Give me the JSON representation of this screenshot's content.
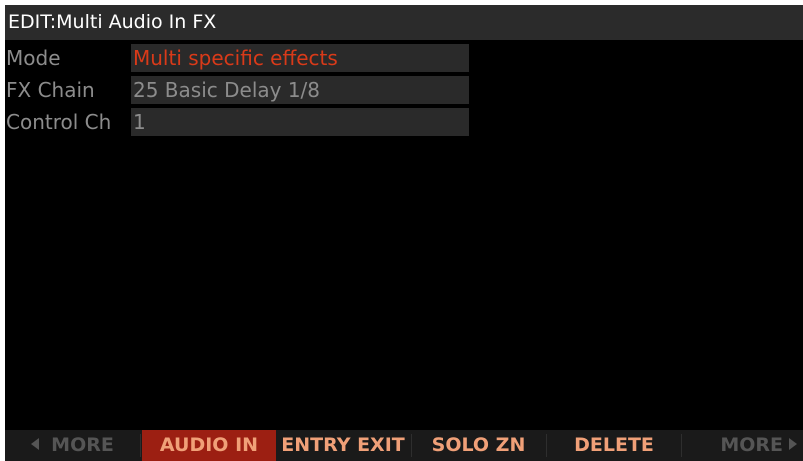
{
  "header": {
    "title": "EDIT:Multi Audio In FX"
  },
  "params": [
    {
      "label": "Mode",
      "value": "Multi specific effects"
    },
    {
      "label": "FX Chain",
      "value": "25 Basic Delay 1/8"
    },
    {
      "label": "Control Ch",
      "value": "1"
    }
  ],
  "softkeys": [
    {
      "label": "MORE",
      "state": "disabled"
    },
    {
      "label": "AUDIO IN",
      "state": "selected"
    },
    {
      "label": "ENTRY EXIT",
      "state": "enabled"
    },
    {
      "label": "SOLO ZN",
      "state": "enabled"
    },
    {
      "label": "DELETE",
      "state": "enabled"
    },
    {
      "label": "MORE",
      "state": "disabled"
    }
  ],
  "colors": {
    "highlight_value": "#d93a19",
    "selected_softkey_bg": "#9c1f12",
    "softkey_text": "#f0a078"
  }
}
